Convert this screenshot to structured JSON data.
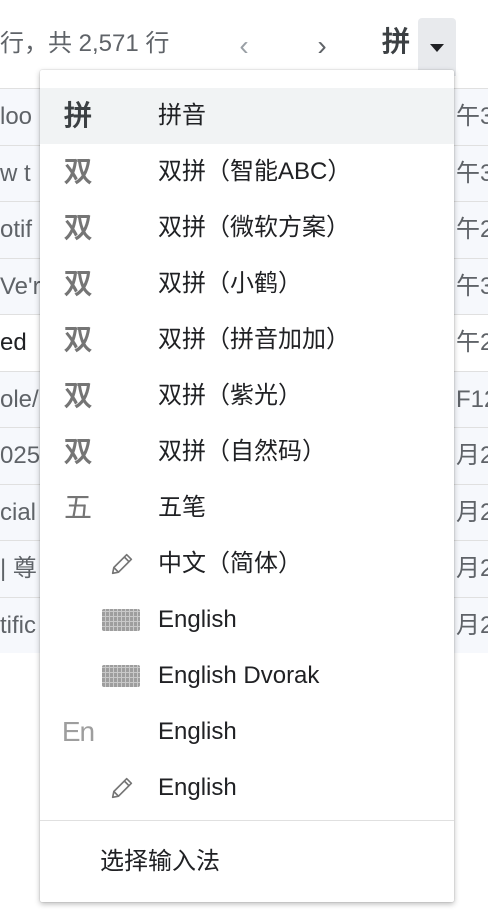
{
  "toolbar": {
    "range_text": "行，共 2,571 行",
    "prev_icon": "chevron-left",
    "next_icon": "chevron-right",
    "ime_glyph": "拼"
  },
  "background_rows": [
    {
      "left": "loo",
      "right": "午3"
    },
    {
      "left": "w t",
      "right": "午3"
    },
    {
      "left": "otif",
      "right": "午2"
    },
    {
      "left": "Ve'r",
      "right": "午3"
    },
    {
      "left": "ed",
      "right": "午2"
    },
    {
      "left": "ole/",
      "right": "F12"
    },
    {
      "left": "025",
      "right": "月2"
    },
    {
      "left": "cial",
      "right": "月2"
    },
    {
      "left": "| 尊",
      "right": "月2"
    },
    {
      "left": "tific",
      "right": "月2"
    }
  ],
  "menu": {
    "items": [
      {
        "icon": "拼",
        "label": "拼音"
      },
      {
        "icon": "双",
        "label": "双拼（智能ABC）"
      },
      {
        "icon": "双",
        "label": "双拼（微软方案）"
      },
      {
        "icon": "双",
        "label": "双拼（小鹤）"
      },
      {
        "icon": "双",
        "label": "双拼（拼音加加）"
      },
      {
        "icon": "双",
        "label": "双拼（紫光）"
      },
      {
        "icon": "双",
        "label": "双拼（自然码）"
      },
      {
        "icon": "五",
        "label": "五笔"
      },
      {
        "icon": "pencil-icon",
        "label": "中文（简体）"
      },
      {
        "icon": "keyboard-icon",
        "label": "English"
      },
      {
        "icon": "keyboard-icon",
        "label": "English Dvorak"
      },
      {
        "icon": "En",
        "label": "English"
      },
      {
        "icon": "pencil-icon",
        "label": "English"
      }
    ],
    "footer_label": "选择输入法"
  }
}
